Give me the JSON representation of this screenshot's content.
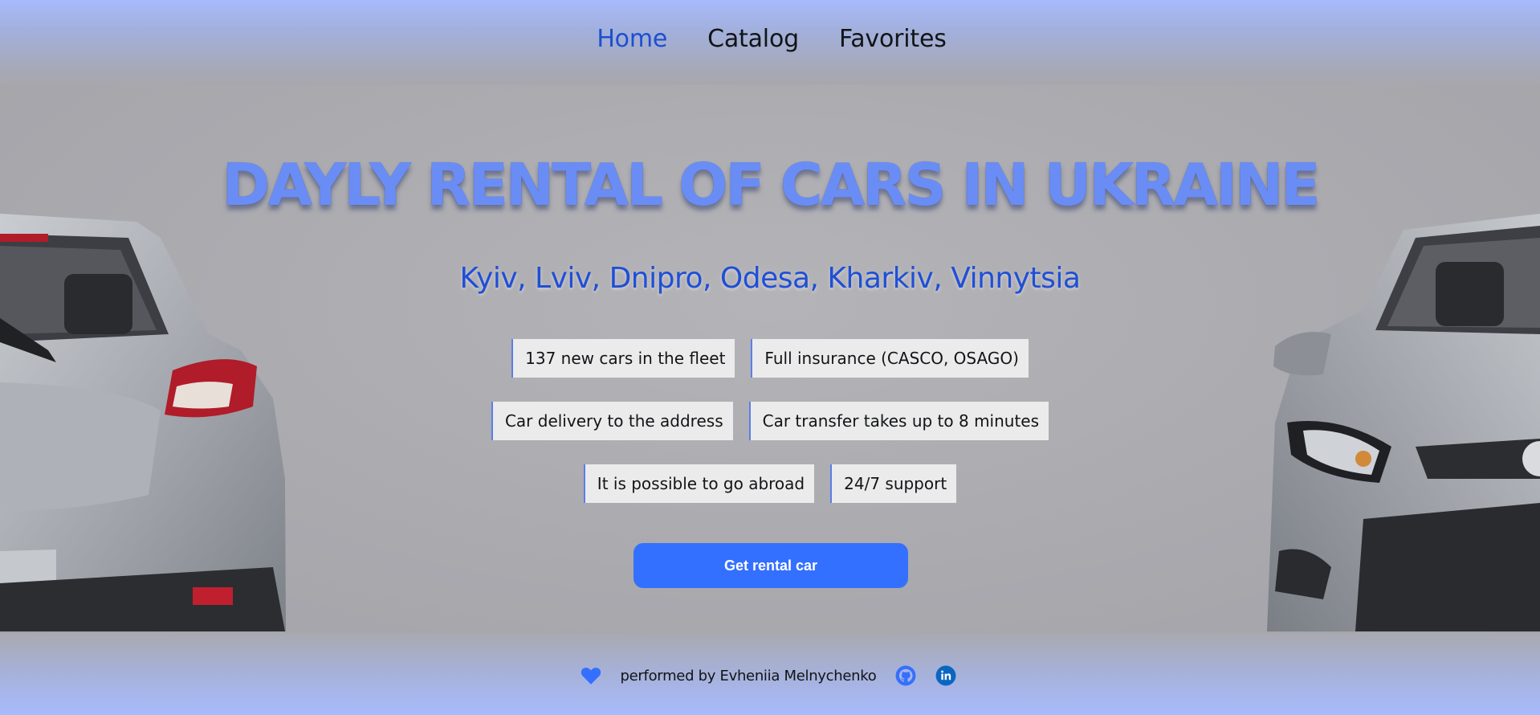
{
  "nav": {
    "items": [
      {
        "label": "Home",
        "active": true
      },
      {
        "label": "Catalog",
        "active": false
      },
      {
        "label": "Favorites",
        "active": false
      }
    ]
  },
  "hero": {
    "title": "DAYLY RENTAL OF CARS IN UKRAINE",
    "cities": "Kyiv, Lviv, Dnipro, Odesa, Kharkiv, Vinnytsia",
    "features": [
      [
        "137 new cars in the fleet",
        "Full insurance (CASCO, OSAGO)"
      ],
      [
        "Car delivery to the address",
        "Car transfer takes up to 8 minutes"
      ],
      [
        "It is possible to go abroad",
        "24/7 support"
      ]
    ],
    "cta_label": "Get rental car"
  },
  "footer": {
    "credit": "performed by Evheniia Melnychenko",
    "icons": [
      "heart-icon",
      "github-icon",
      "linkedin-icon"
    ]
  },
  "colors": {
    "accent": "#3470ff",
    "nav_active": "#1e4fd1",
    "title": "#6a8df5",
    "cities": "#1f4fd6",
    "linkedin": "#0a66c2"
  }
}
